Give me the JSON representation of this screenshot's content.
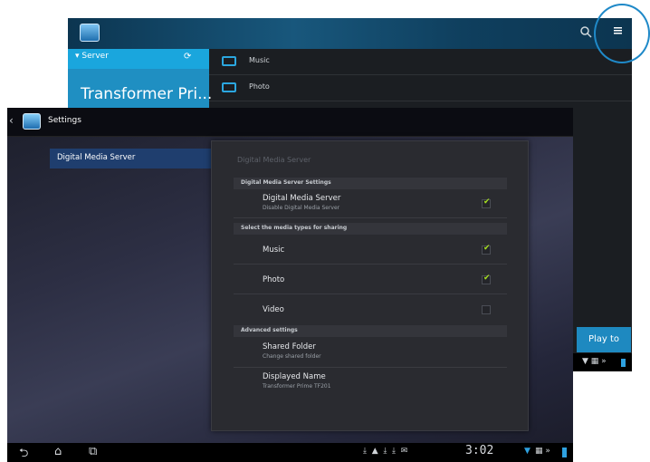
{
  "background_app": {
    "server_label": "Server",
    "device_name": "Transformer Pri...",
    "folders": [
      "Music",
      "Photo"
    ],
    "play_to_label": "Play to",
    "icons": [
      "app-icon",
      "search-icon",
      "menu-icon",
      "refresh-icon"
    ]
  },
  "settings": {
    "title": "Settings",
    "nav_item": "Digital Media Server",
    "panel_title": "Digital Media Server",
    "section_server": "Digital Media Server Settings",
    "server_toggle_title": "Digital Media Server",
    "server_toggle_sub": "Disable Digital Media Server",
    "server_toggle_checked": true,
    "section_types": "Select the media types for sharing",
    "music_label": "Music",
    "music_checked": true,
    "photo_label": "Photo",
    "photo_checked": true,
    "video_label": "Video",
    "video_checked": false,
    "section_advanced": "Advanced settings",
    "shared_folder_title": "Shared Folder",
    "shared_folder_sub": "Change shared folder",
    "displayed_name_title": "Displayed Name",
    "displayed_name_sub": "Transformer Prime TF201"
  },
  "system_bar": {
    "clock": "3:02",
    "icons": [
      "back-icon",
      "home-icon",
      "recent-apps-icon",
      "download-icon",
      "warning-icon",
      "wifi-icon",
      "battery-icon"
    ]
  },
  "colors": {
    "accent": "#1aa6dd",
    "check": "#a6e020",
    "nav_selected": "#1f3e6e",
    "highlight_circle": "#1f89c8"
  }
}
